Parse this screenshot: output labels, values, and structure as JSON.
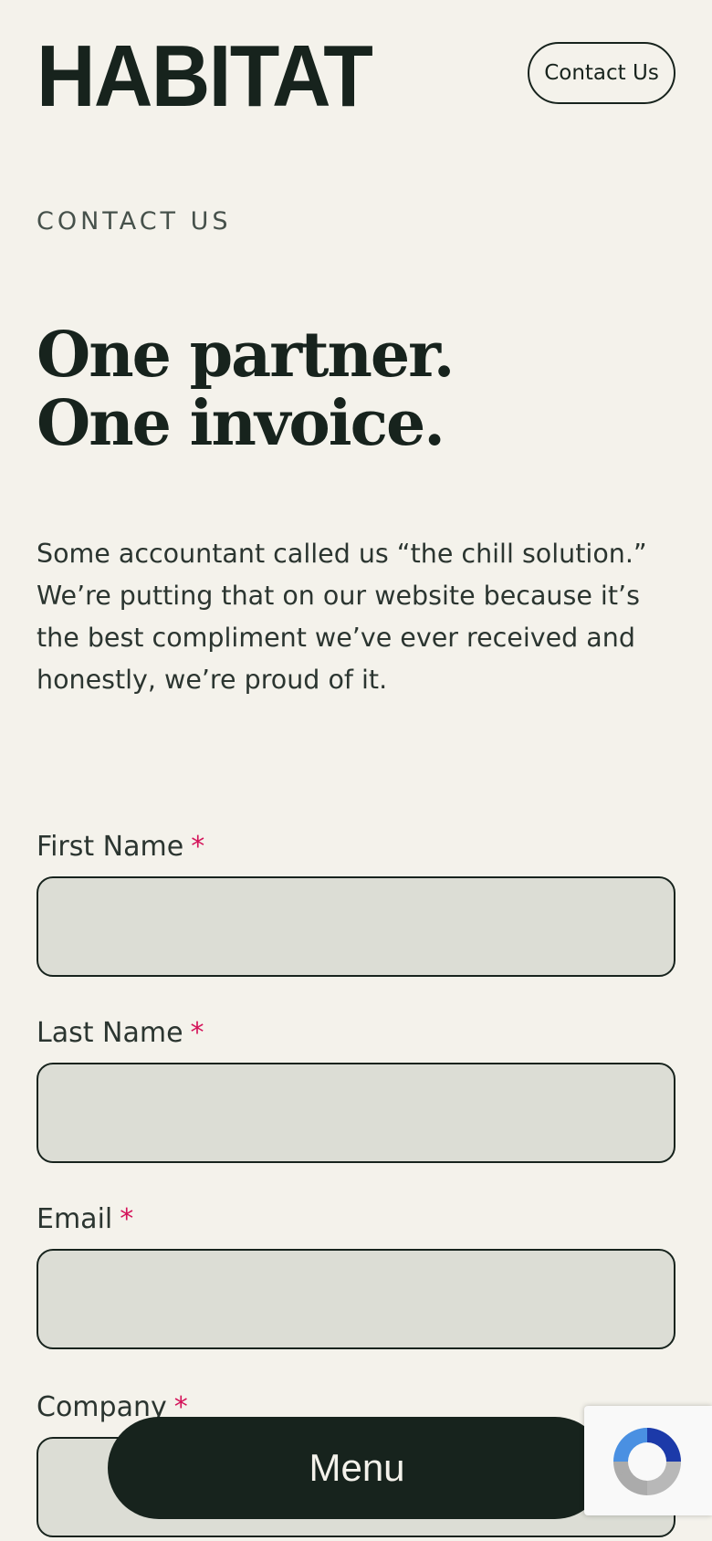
{
  "header": {
    "logo_text": "HABITAT",
    "contact_button_label": "Contact Us"
  },
  "hero": {
    "eyebrow": "CONTACT US",
    "headline_line1": "One partner.",
    "headline_line2": "One invoice.",
    "intro": "Some accountant called us “the chill solution.” We’re putting that on our website because it’s the best compliment we’ve ever received and honestly, we’re proud of it."
  },
  "form": {
    "required_mark": "*",
    "fields": [
      {
        "label": "First Name",
        "value": ""
      },
      {
        "label": "Last Name",
        "value": ""
      },
      {
        "label": "Email",
        "value": ""
      },
      {
        "label": "Company",
        "value": ""
      }
    ]
  },
  "menu_button_label": "Menu",
  "recaptcha": {
    "icon": "recaptcha-icon"
  },
  "colors": {
    "background": "#f4f2eb",
    "ink": "#17231d",
    "input_fill": "#dcddd5",
    "required": "#d4145a"
  }
}
